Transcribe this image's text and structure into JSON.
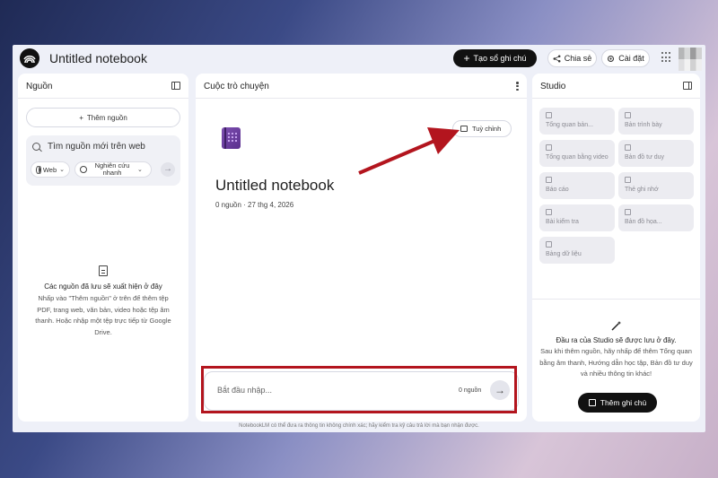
{
  "header": {
    "title": "Untitled notebook",
    "create_label": "Tạo sổ ghi chú",
    "share_label": "Chia sẻ",
    "settings_label": "Cài đặt"
  },
  "sources": {
    "title": "Nguồn",
    "add_label": "Thêm nguồn",
    "search_placeholder": "Tìm nguồn mới trên web",
    "web_chip": "Web",
    "research_chip_line1": "Nghiên cứu",
    "research_chip_line2": "nhanh",
    "empty_title": "Các nguồn đã lưu sẽ xuất hiện ở đây",
    "empty_desc": "Nhấp vào \"Thêm nguồn\" ở trên để thêm tệp PDF, trang web, văn bản, video hoặc tệp âm thanh. Hoặc nhập một tệp trực tiếp từ Google Drive."
  },
  "chat": {
    "title": "Cuộc trò chuyện",
    "customize_label": "Tuỳ chỉnh",
    "notebook_title": "Untitled notebook",
    "meta": "0 nguồn · 27 thg 4, 2026",
    "input_placeholder": "Bắt đầu nhập...",
    "source_count": "0 nguồn"
  },
  "studio": {
    "title": "Studio",
    "tiles": [
      {
        "label": "Tổng quan bản...",
        "icon": "audio-overview-icon"
      },
      {
        "label": "Bản trình bày",
        "icon": "slides-icon"
      },
      {
        "label": "Tổng quan bằng video",
        "icon": "video-overview-icon"
      },
      {
        "label": "Bản đồ tư duy",
        "icon": "mind-map-icon"
      },
      {
        "label": "Báo cáo",
        "icon": "report-icon"
      },
      {
        "label": "Thẻ ghi nhớ",
        "icon": "flashcards-icon"
      },
      {
        "label": "Bài kiểm tra",
        "icon": "quiz-icon"
      },
      {
        "label": "Bản đồ họa...",
        "icon": "infographic-icon"
      },
      {
        "label": "Bảng dữ liệu",
        "icon": "data-table-icon"
      }
    ],
    "empty_title": "Đầu ra của Studio sẽ được lưu ở đây.",
    "empty_desc": "Sau khi thêm nguồn, hãy nhấp để thêm Tổng quan bằng âm thanh, Hướng dẫn học tập, Bản đồ tư duy và nhiều thông tin khác!",
    "add_note_label": "Thêm ghi chú"
  },
  "footer": {
    "disclaimer": "NotebookLM có thể đưa ra thông tin không chính xác; hãy kiểm tra kỹ câu trả lời mà bạn nhận được."
  },
  "colors": {
    "annotation_red": "#b3151e",
    "primary_dark": "#111111",
    "app_bg": "#eef0f8"
  }
}
